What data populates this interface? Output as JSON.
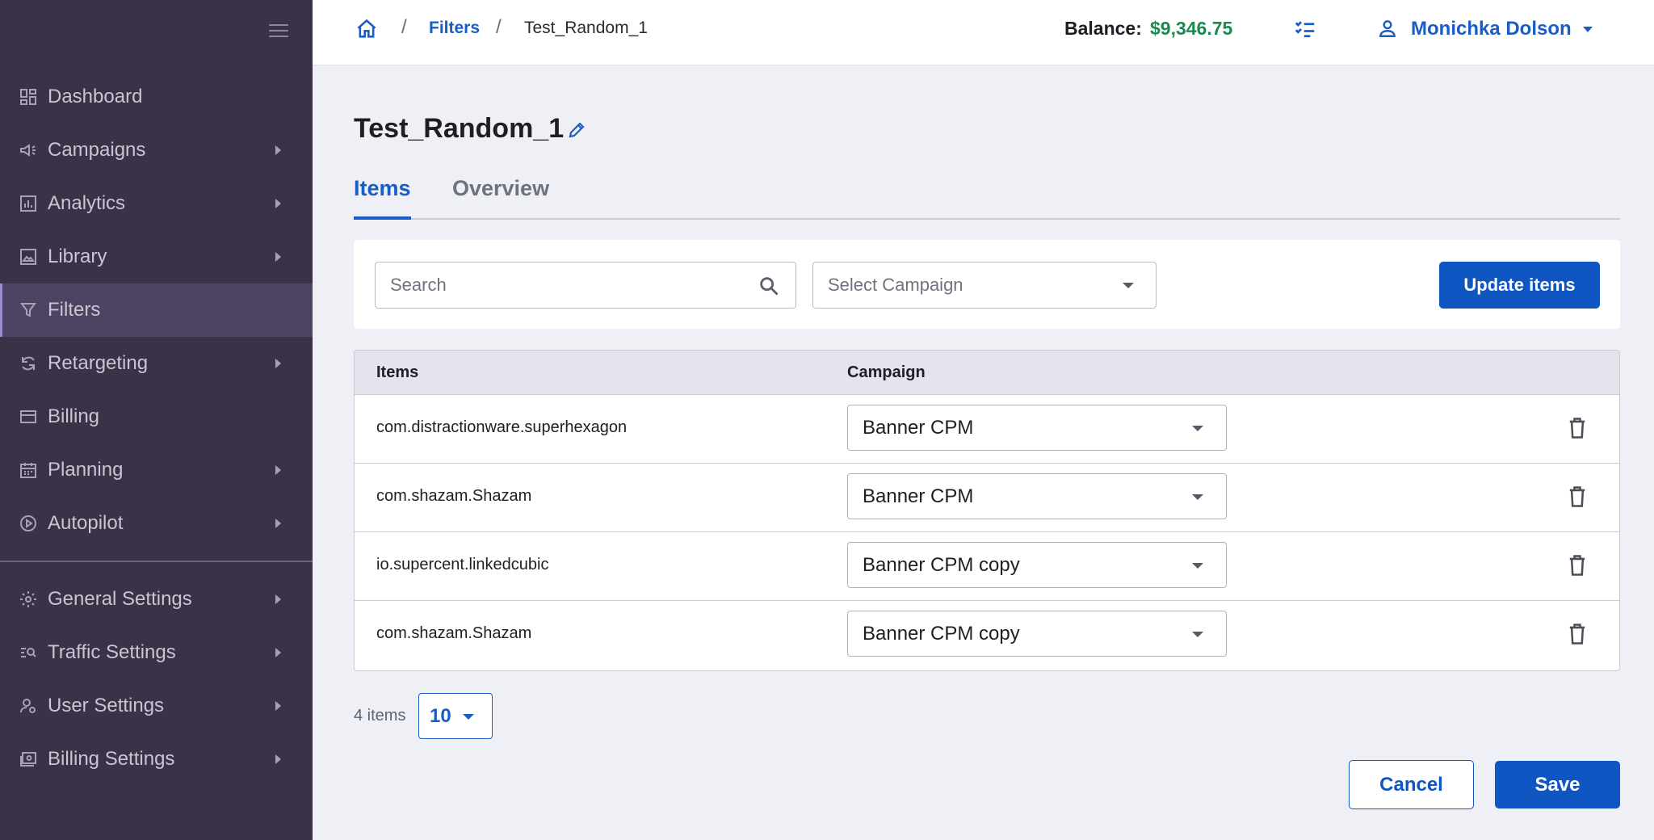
{
  "sidebar": {
    "items": [
      {
        "label": "Dashboard",
        "icon": "dashboard-icon",
        "has_submenu": false,
        "active": false
      },
      {
        "label": "Campaigns",
        "icon": "megaphone-icon",
        "has_submenu": true,
        "active": false
      },
      {
        "label": "Analytics",
        "icon": "bar-chart-icon",
        "has_submenu": true,
        "active": false
      },
      {
        "label": "Library",
        "icon": "image-icon",
        "has_submenu": true,
        "active": false
      },
      {
        "label": "Filters",
        "icon": "funnel-icon",
        "has_submenu": false,
        "active": true
      },
      {
        "label": "Retargeting",
        "icon": "refresh-icon",
        "has_submenu": true,
        "active": false
      },
      {
        "label": "Billing",
        "icon": "credit-card-icon",
        "has_submenu": false,
        "active": false
      },
      {
        "label": "Planning",
        "icon": "calendar-icon",
        "has_submenu": true,
        "active": false
      },
      {
        "label": "Autopilot",
        "icon": "play-circle-icon",
        "has_submenu": true,
        "active": false
      }
    ],
    "settings": [
      {
        "label": "General Settings",
        "icon": "gear-icon",
        "has_submenu": true
      },
      {
        "label": "Traffic Settings",
        "icon": "traffic-search-icon",
        "has_submenu": true
      },
      {
        "label": "User Settings",
        "icon": "user-gear-icon",
        "has_submenu": true
      },
      {
        "label": "Billing Settings",
        "icon": "billing-icon",
        "has_submenu": true
      }
    ]
  },
  "topbar": {
    "breadcrumb": {
      "home_icon": "home-icon",
      "link": "Filters",
      "current": "Test_Random_1"
    },
    "balance_label": "Balance:",
    "balance_value": "$9,346.75",
    "tasks_icon": "checklist-icon",
    "user_name": "Monichka Dolson"
  },
  "page": {
    "title": "Test_Random_1",
    "tabs": [
      {
        "label": "Items",
        "active": true
      },
      {
        "label": "Overview",
        "active": false
      }
    ]
  },
  "filters": {
    "search_placeholder": "Search",
    "campaign_placeholder": "Select Campaign",
    "update_button": "Update items"
  },
  "table": {
    "headers": {
      "items": "Items",
      "campaign": "Campaign"
    },
    "rows": [
      {
        "item": "com.distractionware.superhexagon",
        "campaign": "Banner CPM"
      },
      {
        "item": "com.shazam.Shazam",
        "campaign": "Banner CPM"
      },
      {
        "item": "io.supercent.linkedcubic",
        "campaign": "Banner CPM copy"
      },
      {
        "item": "com.shazam.Shazam",
        "campaign": "Banner CPM copy"
      }
    ]
  },
  "pagination": {
    "count_label": "4 items",
    "per_page": "10"
  },
  "actions": {
    "cancel": "Cancel",
    "save": "Save"
  },
  "colors": {
    "primary": "#0f56c2",
    "sidebar_bg": "#3b3248",
    "balance": "#1a8a4f"
  }
}
